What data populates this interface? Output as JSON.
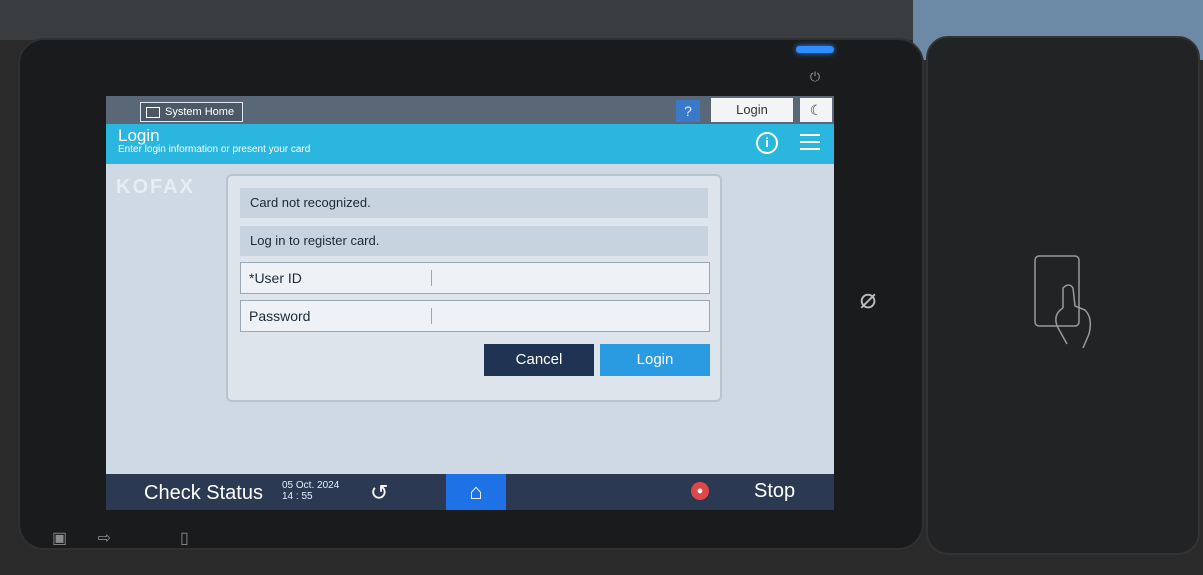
{
  "topbar": {
    "system_home": "System Home",
    "help": "?",
    "login": "Login",
    "moon_icon": "moon-icon"
  },
  "header": {
    "title": "Login",
    "subtitle": "Enter login information or present your card"
  },
  "brand": "KOFAX",
  "dialog": {
    "message1": "Card not recognized.",
    "message2": "Log in to register card.",
    "user_id_label": "*User ID",
    "password_label": "Password",
    "cancel": "Cancel",
    "login": "Login"
  },
  "bottombar": {
    "check_status": "Check Status",
    "date": "05 Oct. 2024",
    "time": "14 : 55",
    "stop": "Stop"
  },
  "colors": {
    "header": "#2ab6df",
    "cancel": "#1f3353",
    "login": "#2a9be0",
    "bottombar": "#2b3a52",
    "home_active": "#1e72e6"
  }
}
